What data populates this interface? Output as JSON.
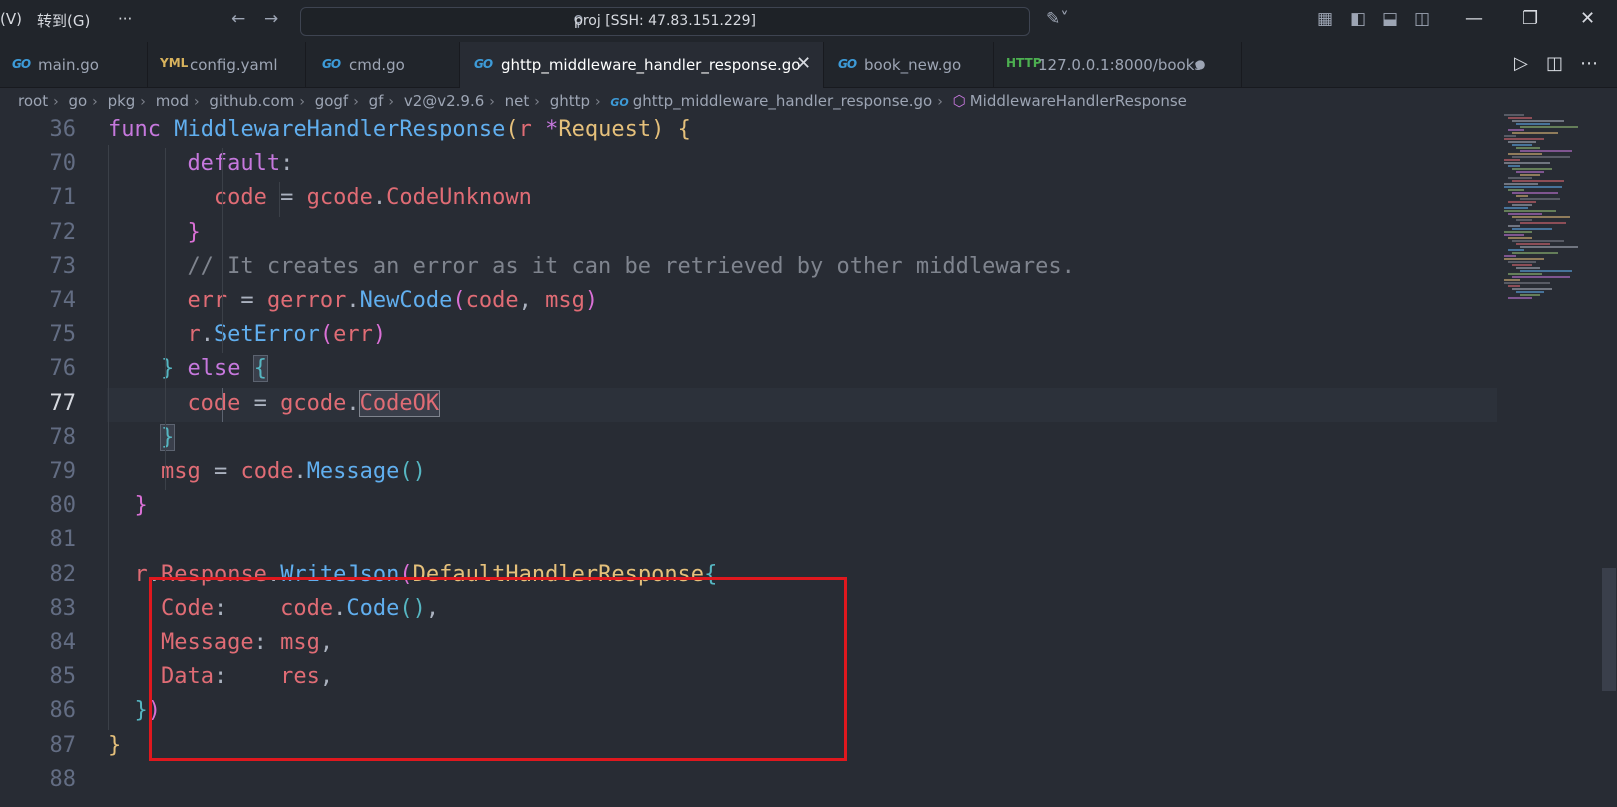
{
  "menu": {
    "view_fragment": "(V)",
    "goto": "转到(G)",
    "more": "···"
  },
  "search": {
    "text": "proj [SSH: 47.83.151.229]"
  },
  "tabs": [
    {
      "label": "main.go",
      "icon": "go-file-icon",
      "active": false
    },
    {
      "label": "config.yaml",
      "icon": "yaml-file-icon",
      "active": false
    },
    {
      "label": "cmd.go",
      "icon": "go-file-icon",
      "active": false
    },
    {
      "label": "ghttp_middleware_handler_response.go",
      "icon": "go-file-icon",
      "active": true
    },
    {
      "label": "book_new.go",
      "icon": "go-file-icon",
      "active": false
    },
    {
      "label": "127.0.0.1:8000/books",
      "icon": "http-file-icon",
      "active": false
    }
  ],
  "icons": {
    "go": "GO",
    "yaml": "YML",
    "http": "HTTP"
  },
  "breadcrumb": [
    "root",
    "go",
    "pkg",
    "mod",
    "github.com",
    "gogf",
    "gf",
    "v2@v2.9.6",
    "net",
    "ghttp",
    "ghttp_middleware_handler_response.go",
    "MiddlewareHandlerResponse"
  ],
  "lines": [
    {
      "num": "36",
      "text": "func MiddlewareHandlerResponse(r *Request) {"
    },
    {
      "num": "70",
      "text": "default:"
    },
    {
      "num": "71",
      "text": "code = gcode.CodeUnknown"
    },
    {
      "num": "72",
      "text": "}"
    },
    {
      "num": "73",
      "text": "// It creates an error as it can be retrieved by other middlewares."
    },
    {
      "num": "74",
      "text": "err = gerror.NewCode(code, msg)"
    },
    {
      "num": "75",
      "text": "r.SetError(err)"
    },
    {
      "num": "76",
      "text": "} else {"
    },
    {
      "num": "77",
      "text": "code = gcode.CodeOK"
    },
    {
      "num": "78",
      "text": "}"
    },
    {
      "num": "79",
      "text": "msg = code.Message()"
    },
    {
      "num": "80",
      "text": "}"
    },
    {
      "num": "81",
      "text": ""
    },
    {
      "num": "82",
      "text": "r.Response.WriteJson(DefaultHandlerResponse{"
    },
    {
      "num": "83",
      "text": "Code:    code.Code(),"
    },
    {
      "num": "84",
      "text": "Message: msg,"
    },
    {
      "num": "85",
      "text": "Data:    res,"
    },
    {
      "num": "86",
      "text": "})"
    },
    {
      "num": "87",
      "text": "}"
    },
    {
      "num": "88",
      "text": ""
    }
  ],
  "current_line": "77",
  "colors": {
    "background": "#282c34",
    "highlight_box": "#e0181e",
    "keyword": "#c678dd",
    "function": "#61afef",
    "variable": "#e06c75",
    "type": "#e5c07b"
  }
}
